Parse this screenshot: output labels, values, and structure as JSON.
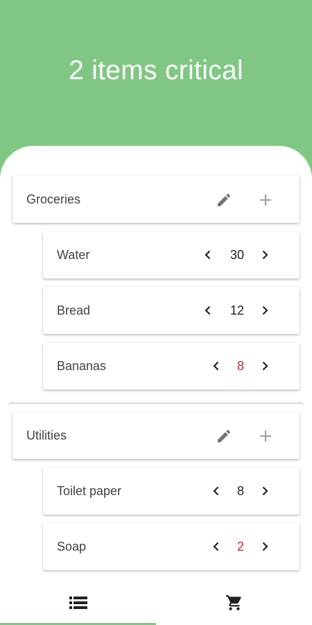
{
  "header": {
    "title": "2 items critical"
  },
  "colors": {
    "accent": "#81c784",
    "critical": "#c62828",
    "text": "#424242",
    "icon": "#757575"
  },
  "categories": [
    {
      "name": "Groceries",
      "edit_icon": "pencil-icon",
      "add_icon": "plus-icon",
      "items": [
        {
          "name": "Water",
          "count": "30",
          "critical": false
        },
        {
          "name": "Bread",
          "count": "12",
          "critical": false
        },
        {
          "name": "Bananas",
          "count": "8",
          "critical": true
        }
      ]
    },
    {
      "name": "Utilities",
      "edit_icon": "pencil-icon",
      "add_icon": "plus-icon",
      "items": [
        {
          "name": "Toilet paper",
          "count": "8",
          "critical": false
        },
        {
          "name": "Soap",
          "count": "2",
          "critical": true
        }
      ]
    }
  ],
  "bottom_nav": {
    "tabs": [
      {
        "icon": "list-icon",
        "active": true
      },
      {
        "icon": "shopping-cart-icon",
        "active": false
      }
    ]
  }
}
